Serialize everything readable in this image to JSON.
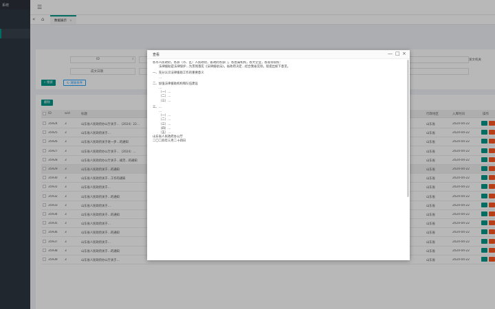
{
  "sidebar": {
    "brand": "系统",
    "items": [
      "",
      "",
      "",
      "",
      "",
      "",
      "",
      "",
      "",
      "",
      "",
      "",
      "",
      "",
      "",
      "",
      "",
      "",
      "",
      "",
      "",
      "",
      "",
      "",
      "",
      "",
      "",
      ""
    ]
  },
  "tabs": {
    "current": "数据展示",
    "close": "×"
  },
  "search": {
    "id_label": "ID",
    "date_label": "成文日期",
    "dept_label": "发文机关",
    "search_button": "搜索",
    "reset_button": "清除条件"
  },
  "table": {
    "delete_button": "删除",
    "headers": {
      "id": "ID",
      "wid": "wid",
      "title": "标题",
      "agency": "行政地区",
      "date": "入库时间",
      "ops": "操作"
    },
    "rows": [
      {
        "id": "35924",
        "wid": "3",
        "title": "山东省人民政府办公厅关于…（2024）22…",
        "agency": "山东省",
        "date": "2024-04-22"
      },
      {
        "id": "35925",
        "wid": "3",
        "title": "山东省人民政府关于…",
        "agency": "山东省",
        "date": "2024-04-22"
      },
      {
        "id": "35926",
        "wid": "3",
        "title": "山东省人民政府关于进一步…的通知",
        "agency": "山东省",
        "date": "2024-04-22"
      },
      {
        "id": "35927",
        "wid": "3",
        "title": "山东省人民政府办公厅关于…（2024）…",
        "agency": "山东省",
        "date": "2024-04-22"
      },
      {
        "id": "35928",
        "wid": "3",
        "title": "山东省人民政府办公厅关于…规范…的通知",
        "agency": "山东省",
        "date": "2024-04-22"
      },
      {
        "id": "35929",
        "wid": "3",
        "title": "山东省人民政府关于…的通知",
        "agency": "山东省",
        "date": "2024-04-22"
      },
      {
        "id": "35930",
        "wid": "3",
        "title": "山东省人民政府关于…工作的通知",
        "agency": "山东省",
        "date": "2024-04-22"
      },
      {
        "id": "35931",
        "wid": "3",
        "title": "山东省人民政府关于…",
        "agency": "山东省",
        "date": "2024-04-22"
      },
      {
        "id": "35932",
        "wid": "3",
        "title": "山东省人民政府关于…的通知",
        "agency": "山东省",
        "date": "2024-04-22"
      },
      {
        "id": "35933",
        "wid": "3",
        "title": "山东省人民政府关于…",
        "agency": "山东省",
        "date": "2024-04-22"
      },
      {
        "id": "35934",
        "wid": "3",
        "title": "山东省人民政府关于…的通知",
        "agency": "山东省",
        "date": "2024-04-22"
      },
      {
        "id": "35935",
        "wid": "3",
        "title": "山东省人民政府关于…",
        "agency": "山东省",
        "date": "2024-04-22"
      },
      {
        "id": "35936",
        "wid": "3",
        "title": "山东省人民政府关于…的通知",
        "agency": "山东省",
        "date": "2024-04-22"
      },
      {
        "id": "35937",
        "wid": "3",
        "title": "山东省人民政府关于…",
        "agency": "山东省",
        "date": "2024-04-22"
      },
      {
        "id": "35938",
        "wid": "3",
        "title": "山东省人民政府关于…的通知",
        "agency": "山东省",
        "date": "2024-04-22"
      },
      {
        "id": "35939",
        "wid": "3",
        "title": "山东省人民政府办公厅关于…",
        "agency": "山东省",
        "date": "2024-04-22"
      }
    ]
  },
  "dialog": {
    "title": "查看",
    "minimize": "—",
    "maximize": "□",
    "close": "×",
    "paragraphs": [
      {
        "cls": "noindent",
        "text": "各市人民政府，各县（市、区）人民政府，省政府各部门，各直属机构，各大企业，各高等院校："
      },
      {
        "cls": "",
        "text": "法律援助是法律保护…为贯彻落实《法律援助法》，省政府决定…结合我省实际，现提出如下意见。"
      },
      {
        "cls": "head",
        "text": "一、充分认识法律援助工作的重要意义"
      },
      {
        "cls": "",
        "text": "…"
      },
      {
        "cls": "head",
        "text": "二、加强法律援助机构和队伍建设"
      },
      {
        "cls": "",
        "text": "…"
      },
      {
        "cls": "",
        "text": "（一）…"
      },
      {
        "cls": "",
        "text": "（二）…"
      },
      {
        "cls": "",
        "text": "（三）…"
      },
      {
        "cls": "head",
        "text": "三、…"
      },
      {
        "cls": "",
        "text": "…"
      },
      {
        "cls": "",
        "text": "（一）…"
      },
      {
        "cls": "",
        "text": "（二）…"
      },
      {
        "cls": "",
        "text": "（三）…"
      },
      {
        "cls": "",
        "text": "（四）…"
      },
      {
        "cls": "",
        "text": "（五）…"
      },
      {
        "cls": "noindent",
        "text": "山东省人民政府办公厅"
      },
      {
        "cls": "noindent",
        "text": "二〇二四年三月二十四日"
      }
    ]
  }
}
